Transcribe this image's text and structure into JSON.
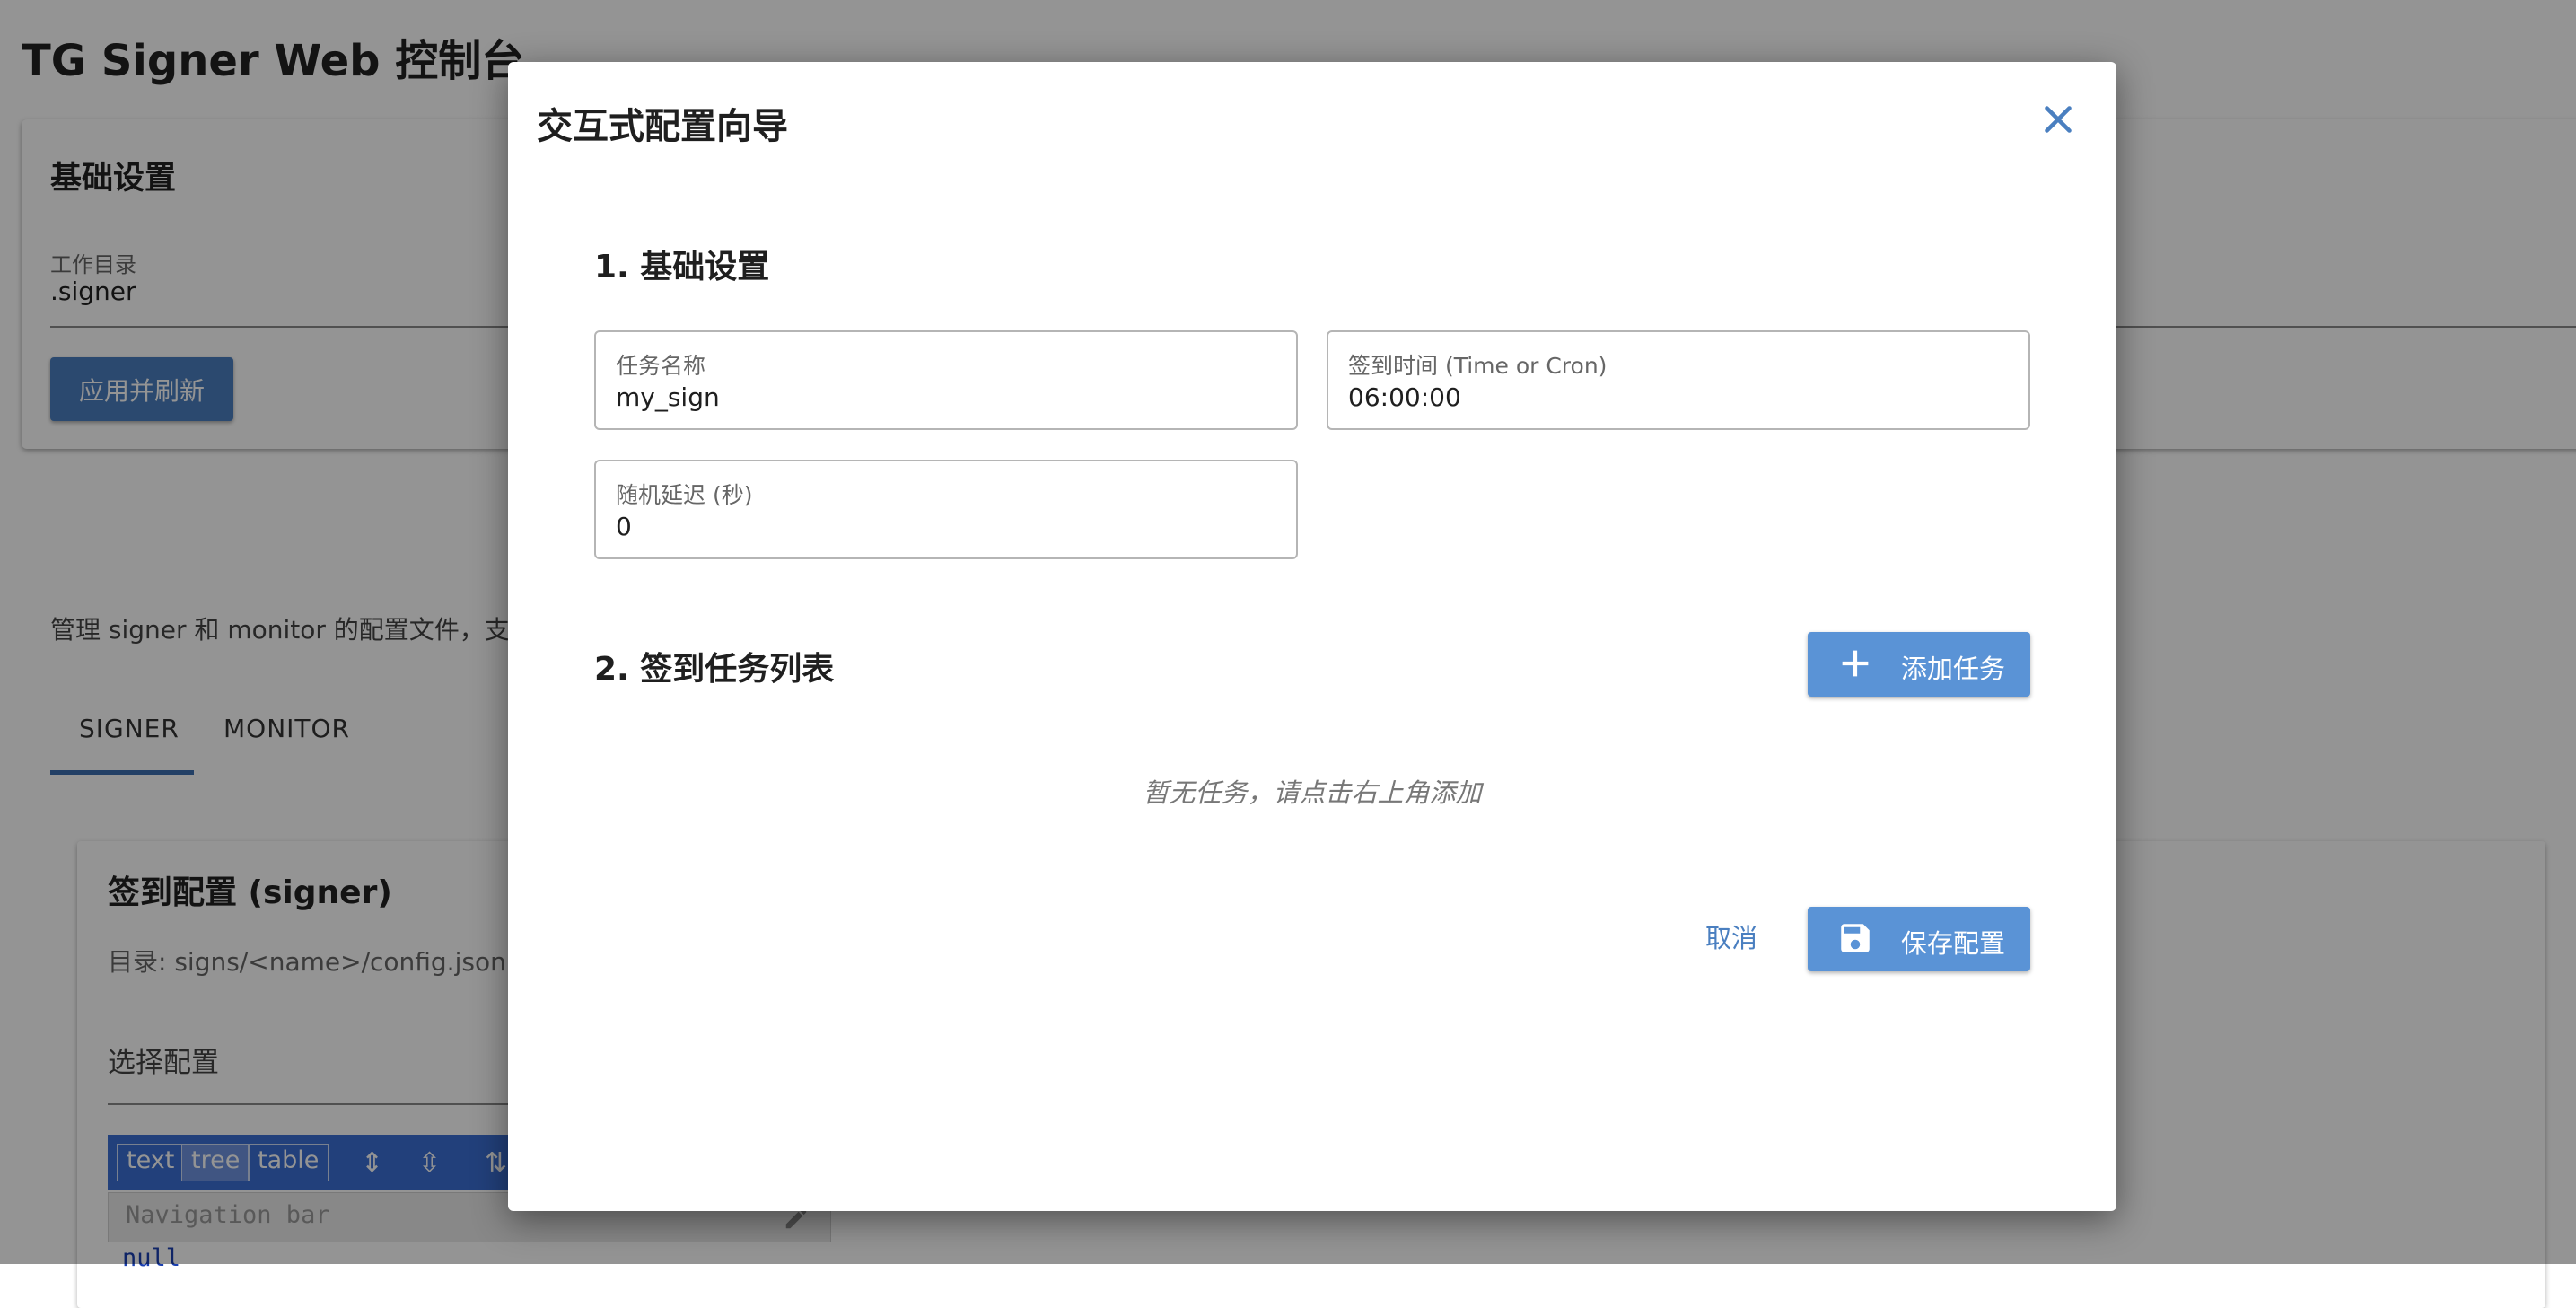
{
  "app": {
    "title": "TG Signer Web 控制台"
  },
  "basic_settings": {
    "title": "基础设置",
    "workdir_label": "工作目录",
    "workdir_value": ".signer",
    "apply_button": "应用并刷新"
  },
  "config_manager": {
    "description": "管理 signer 和 monitor 的配置文件，支持",
    "tabs": [
      {
        "label": "SIGNER",
        "active": true
      },
      {
        "label": "MONITOR",
        "active": false
      }
    ],
    "panel_title": "签到配置 (signer)",
    "panel_dir": "目录: signs/<name>/config.json",
    "select_label": "选择配置",
    "editor": {
      "modes": [
        "text",
        "tree",
        "table"
      ],
      "active_mode": "tree",
      "nav_placeholder": "Navigation bar",
      "content": "null"
    }
  },
  "dialog": {
    "title": "交互式配置向导",
    "section1_title": "1. 基础设置",
    "fields": {
      "task_name": {
        "label": "任务名称",
        "value": "my_sign"
      },
      "sign_time": {
        "label": "签到时间 (Time or Cron)",
        "value": "06:00:00"
      },
      "random_delay": {
        "label": "随机延迟 (秒)",
        "value": "0"
      }
    },
    "section2_title": "2. 签到任务列表",
    "add_task_button": "添加任务",
    "empty_text": "暂无任务，请点击右上角添加",
    "cancel_button": "取消",
    "save_button": "保存配置"
  },
  "colors": {
    "primary": "#5a93d6",
    "accent": "#4a7fc0",
    "editor_bar": "#3b6fd4"
  },
  "icons": {
    "close": "close-icon",
    "add": "plus-icon",
    "save": "floppy-disk-icon"
  }
}
